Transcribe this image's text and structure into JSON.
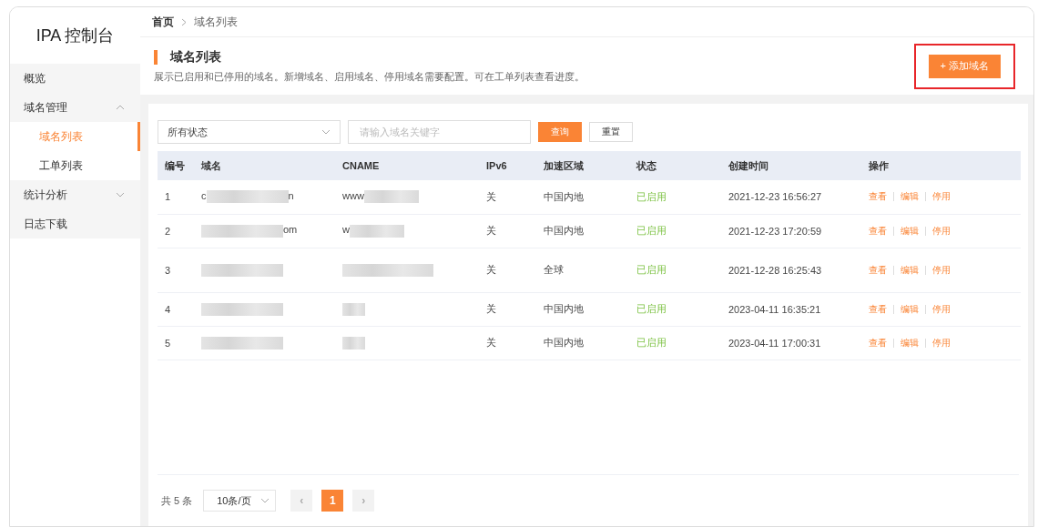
{
  "sidebar": {
    "title": "IPA 控制台",
    "items": [
      {
        "label": "概览",
        "selected": false
      },
      {
        "label": "域名管理",
        "selected": false,
        "expanded": true,
        "children": [
          {
            "label": "域名列表",
            "selected": true
          },
          {
            "label": "工单列表",
            "selected": false
          }
        ]
      },
      {
        "label": "统计分析",
        "selected": false,
        "expanded": false
      },
      {
        "label": "日志下载",
        "selected": false
      }
    ]
  },
  "breadcrumb": [
    "首页",
    "域名列表"
  ],
  "page_header": {
    "title": "域名列表",
    "description": "展示已启用和已停用的域名。新增域名、启用域名、停用域名需要配置。可在工单列表查看进度。",
    "add_button": {
      "icon": "+",
      "label": "添加域名",
      "highlighted": true
    }
  },
  "filters": {
    "status_select": "所有状态",
    "keyword": {
      "placeholder": "请输入域名关键字"
    },
    "query_button": "查询",
    "reset_button": "重置"
  },
  "table": {
    "columns": [
      "编号",
      "域名",
      "CNAME",
      "IPv6",
      "加速区域",
      "状态",
      "创建时间",
      "操作"
    ],
    "rows": [
      {
        "id": "1",
        "domain": {
          "start": "c",
          "end": "n",
          "redacted": true
        },
        "cname": {
          "start": "www",
          "redacted": true
        },
        "ipv6": "关",
        "region": "中国内地",
        "status": "已启用",
        "created": "2021-12-23 16:56:27",
        "actions": [
          "查看",
          "编辑",
          "停用"
        ]
      },
      {
        "id": "2",
        "domain": {
          "end": "om",
          "redacted": true
        },
        "cname": {
          "start": "w",
          "redacted": true
        },
        "ipv6": "关",
        "region": "中国内地",
        "status": "已启用",
        "created": "2021-12-23 17:20:59",
        "actions": [
          "查看",
          "编辑",
          "停用"
        ]
      },
      {
        "id": "3",
        "domain": {
          "redacted": true
        },
        "cname": {
          "redacted": true
        },
        "ipv6": "关",
        "region": "全球",
        "status": "已启用",
        "created": "2021-12-28 16:25:43",
        "actions": [
          "查看",
          "编辑",
          "停用"
        ]
      },
      {
        "id": "4",
        "domain": {
          "redacted": true
        },
        "cname": {
          "redacted": true
        },
        "ipv6": "关",
        "region": "中国内地",
        "status": "已启用",
        "created": "2023-04-11 16:35:21",
        "actions": [
          "查看",
          "编辑",
          "停用"
        ]
      },
      {
        "id": "5",
        "domain": {
          "redacted": true
        },
        "cname": {
          "redacted": true
        },
        "ipv6": "关",
        "region": "中国内地",
        "status": "已启用",
        "created": "2023-04-11 17:00:31",
        "actions": [
          "查看",
          "编辑",
          "停用"
        ]
      }
    ]
  },
  "pagination": {
    "total": "共 5 条",
    "page_size": "10条/页",
    "prev": "‹",
    "next": "›",
    "pages": [
      {
        "label": "1",
        "selected": true
      }
    ]
  }
}
